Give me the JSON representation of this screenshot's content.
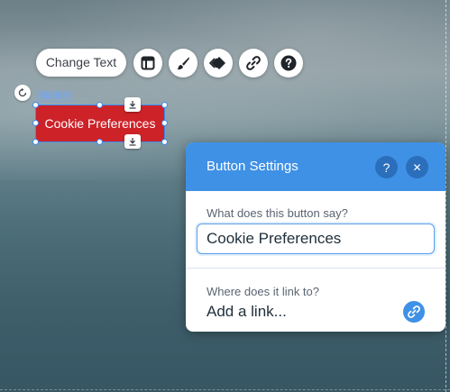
{
  "toolbar": {
    "change_text_label": "Change Text",
    "icons": [
      "layout-icon",
      "paintbrush-icon",
      "animation-icon",
      "link-icon",
      "help-icon"
    ]
  },
  "element": {
    "type_tag": "Button",
    "label": "Cookie Preferences",
    "color": "#cc2228",
    "selection_color": "#3b8df0"
  },
  "panel": {
    "title": "Button Settings",
    "help_label": "?",
    "close_label": "✕",
    "text_field": {
      "label": "What does this button say?",
      "value": "Cookie Preferences"
    },
    "link_field": {
      "label": "Where does it link to?",
      "value": "Add a link..."
    },
    "accent": "#3f91e6"
  }
}
